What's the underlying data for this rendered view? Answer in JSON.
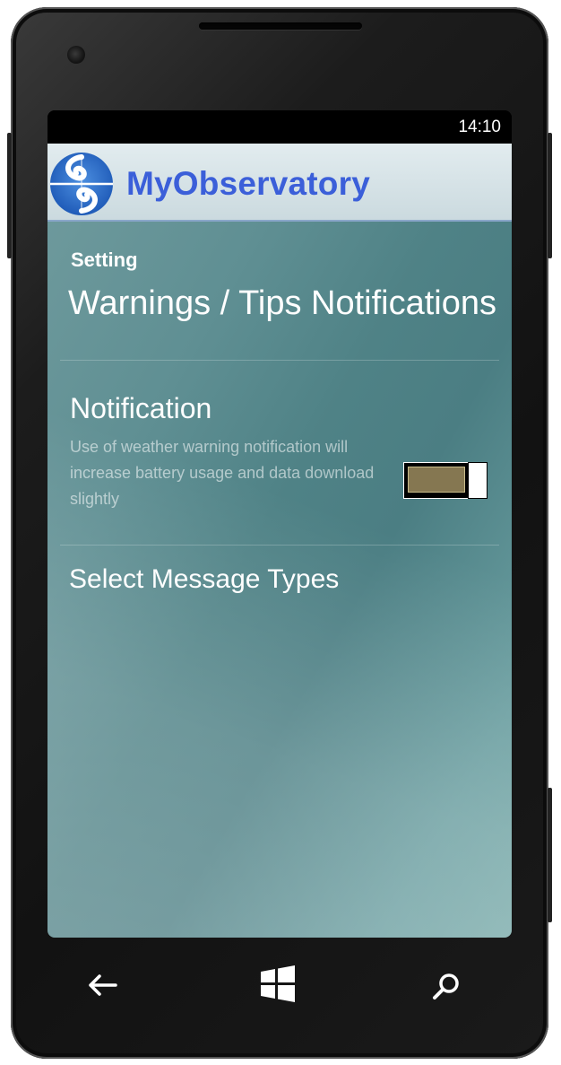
{
  "status_bar": {
    "time": "14:10"
  },
  "app_bar": {
    "title": "MyObservatory",
    "logo_icon": "observatory-logo-icon",
    "title_color": "#3b5fd9"
  },
  "page": {
    "section_label": "Setting",
    "heading": "Warnings / Tips Notifications"
  },
  "notification": {
    "title": "Notification",
    "description": "Use of weather warning notification will increase battery usage and data download slightly",
    "toggle_on": true,
    "toggle_fill_color": "#857751"
  },
  "message_types": {
    "label": "Select Message Types"
  },
  "nav_bar": {
    "back_icon": "back-arrow-icon",
    "home_icon": "windows-logo-icon",
    "search_icon": "search-icon"
  }
}
